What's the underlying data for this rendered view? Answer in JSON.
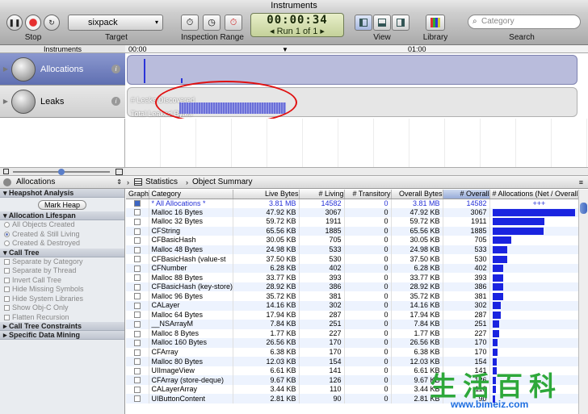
{
  "window": {
    "title": "Instruments"
  },
  "toolbar": {
    "stop_label": "Stop",
    "target_label": "Target",
    "target_value": "sixpack",
    "inspection_label": "Inspection Range",
    "timer": "00:00:34",
    "run": "Run 1 of 1",
    "view_label": "View",
    "library_label": "Library",
    "search_label": "Search",
    "search_placeholder": "Category"
  },
  "timeline": {
    "header": "Instruments",
    "ruler_start": "00:00",
    "ruler_mid": "01:00",
    "instruments": [
      {
        "name": "Allocations",
        "selected": true
      },
      {
        "name": "Leaks",
        "selected": false
      }
    ],
    "leaks_track": {
      "line1": "# Leaks Discovered",
      "line2": "Total Leaked Bytes"
    }
  },
  "navbar": {
    "instrument": "Allocations",
    "view": "Statistics",
    "summary": "Object Summary"
  },
  "sidebar": {
    "heapshot": {
      "title": "Heapshot Analysis",
      "button": "Mark Heap"
    },
    "lifespan": {
      "title": "Allocation Lifespan",
      "options": [
        "All Objects Created",
        "Created & Still Living",
        "Created & Destroyed"
      ],
      "selected_index": 1
    },
    "calltree": {
      "title": "Call Tree",
      "options": [
        "Separate by Category",
        "Separate by Thread",
        "Invert Call Tree",
        "Hide Missing Symbols",
        "Hide System Libraries",
        "Show Obj-C Only",
        "Flatten Recursion"
      ]
    },
    "constraints": {
      "title": "Call Tree Constraints"
    },
    "mining": {
      "title": "Specific Data Mining"
    }
  },
  "table": {
    "columns": [
      "Graph",
      "Category",
      "Live Bytes",
      "# Living",
      "# Transitory",
      "Overall Bytes",
      "# Overall",
      "# Allocations (Net / Overall)"
    ],
    "rows": [
      {
        "graph": true,
        "category": "* All Allocations *",
        "live_bytes": "3.81 MB",
        "living": "14582",
        "transitory": "0",
        "overall_bytes": "3.81 MB",
        "overall": "14582",
        "bar": "+++"
      },
      {
        "graph": false,
        "category": "Malloc 16 Bytes",
        "live_bytes": "47.92 KB",
        "living": "3067",
        "transitory": "0",
        "overall_bytes": "47.92 KB",
        "overall": "3067"
      },
      {
        "graph": false,
        "category": "Malloc 32 Bytes",
        "live_bytes": "59.72 KB",
        "living": "1911",
        "transitory": "0",
        "overall_bytes": "59.72 KB",
        "overall": "1911"
      },
      {
        "graph": false,
        "category": "CFString",
        "live_bytes": "65.56 KB",
        "living": "1885",
        "transitory": "0",
        "overall_bytes": "65.56 KB",
        "overall": "1885"
      },
      {
        "graph": false,
        "category": "CFBasicHash",
        "live_bytes": "30.05 KB",
        "living": "705",
        "transitory": "0",
        "overall_bytes": "30.05 KB",
        "overall": "705"
      },
      {
        "graph": false,
        "category": "Malloc 48 Bytes",
        "live_bytes": "24.98 KB",
        "living": "533",
        "transitory": "0",
        "overall_bytes": "24.98 KB",
        "overall": "533"
      },
      {
        "graph": false,
        "category": "CFBasicHash (value-st",
        "live_bytes": "37.50 KB",
        "living": "530",
        "transitory": "0",
        "overall_bytes": "37.50 KB",
        "overall": "530"
      },
      {
        "graph": false,
        "category": "CFNumber",
        "live_bytes": "6.28 KB",
        "living": "402",
        "transitory": "0",
        "overall_bytes": "6.28 KB",
        "overall": "402"
      },
      {
        "graph": false,
        "category": "Malloc 88 Bytes",
        "live_bytes": "33.77 KB",
        "living": "393",
        "transitory": "0",
        "overall_bytes": "33.77 KB",
        "overall": "393"
      },
      {
        "graph": false,
        "category": "CFBasicHash (key-store)",
        "live_bytes": "28.92 KB",
        "living": "386",
        "transitory": "0",
        "overall_bytes": "28.92 KB",
        "overall": "386"
      },
      {
        "graph": false,
        "category": "Malloc 96 Bytes",
        "live_bytes": "35.72 KB",
        "living": "381",
        "transitory": "0",
        "overall_bytes": "35.72 KB",
        "overall": "381"
      },
      {
        "graph": false,
        "category": "CALayer",
        "live_bytes": "14.16 KB",
        "living": "302",
        "transitory": "0",
        "overall_bytes": "14.16 KB",
        "overall": "302"
      },
      {
        "graph": false,
        "category": "Malloc 64 Bytes",
        "live_bytes": "17.94 KB",
        "living": "287",
        "transitory": "0",
        "overall_bytes": "17.94 KB",
        "overall": "287"
      },
      {
        "graph": false,
        "category": "__NSArrayM",
        "live_bytes": "7.84 KB",
        "living": "251",
        "transitory": "0",
        "overall_bytes": "7.84 KB",
        "overall": "251"
      },
      {
        "graph": false,
        "category": "Malloc 8 Bytes",
        "live_bytes": "1.77 KB",
        "living": "227",
        "transitory": "0",
        "overall_bytes": "1.77 KB",
        "overall": "227"
      },
      {
        "graph": false,
        "category": "Malloc 160 Bytes",
        "live_bytes": "26.56 KB",
        "living": "170",
        "transitory": "0",
        "overall_bytes": "26.56 KB",
        "overall": "170"
      },
      {
        "graph": false,
        "category": "CFArray",
        "live_bytes": "6.38 KB",
        "living": "170",
        "transitory": "0",
        "overall_bytes": "6.38 KB",
        "overall": "170"
      },
      {
        "graph": false,
        "category": "Malloc 80 Bytes",
        "live_bytes": "12.03 KB",
        "living": "154",
        "transitory": "0",
        "overall_bytes": "12.03 KB",
        "overall": "154"
      },
      {
        "graph": false,
        "category": "UIImageView",
        "live_bytes": "6.61 KB",
        "living": "141",
        "transitory": "0",
        "overall_bytes": "6.61 KB",
        "overall": "141"
      },
      {
        "graph": false,
        "category": "CFArray (store-deque)",
        "live_bytes": "9.67 KB",
        "living": "126",
        "transitory": "0",
        "overall_bytes": "9.67 KB",
        "overall": "126"
      },
      {
        "graph": false,
        "category": "CALayerArray",
        "live_bytes": "3.44 KB",
        "living": "110",
        "transitory": "0",
        "overall_bytes": "3.44 KB",
        "overall": "110"
      },
      {
        "graph": false,
        "category": "UIButtonContent",
        "live_bytes": "2.81 KB",
        "living": "90",
        "transitory": "0",
        "overall_bytes": "2.81 KB",
        "overall": "90"
      }
    ]
  },
  "watermark": {
    "chars": "生活百科",
    "url": "www.bimeiz.com"
  },
  "colors": {
    "selection": "#5f6fb1",
    "bar": "#1a24e0",
    "annotation": "#e01010",
    "watermark": "#2ea83a"
  }
}
